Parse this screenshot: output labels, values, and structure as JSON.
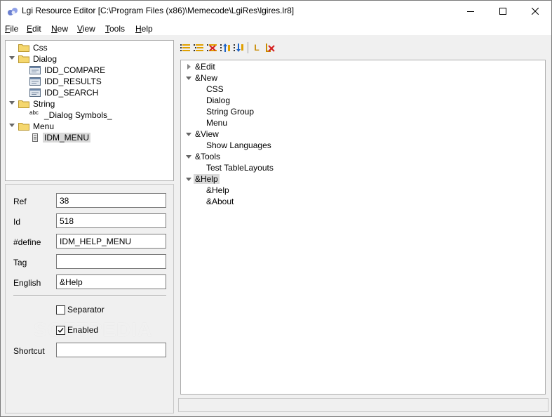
{
  "window": {
    "title": "Lgi Resource Editor [C:\\Program Files (x86)\\Memecode\\LgiRes\\lgires.lr8]"
  },
  "menubar": {
    "items": [
      "File",
      "Edit",
      "New",
      "View",
      "Tools",
      "Help"
    ]
  },
  "resource_tree": {
    "items": [
      {
        "label": "Css",
        "icon": "folder-icon",
        "expanded": false
      },
      {
        "label": "Dialog",
        "icon": "folder-icon",
        "expanded": true
      },
      {
        "label": "IDD_COMPARE",
        "icon": "dialog-icon"
      },
      {
        "label": "IDD_RESULTS",
        "icon": "dialog-icon"
      },
      {
        "label": "IDD_SEARCH",
        "icon": "dialog-icon"
      },
      {
        "label": "String",
        "icon": "folder-icon",
        "expanded": true
      },
      {
        "label": "_Dialog Symbols_",
        "icon": "string-icon",
        "icon_text": "abc"
      },
      {
        "label": "Menu",
        "icon": "folder-icon",
        "expanded": true
      },
      {
        "label": "IDM_MENU",
        "icon": "menu-resource-icon",
        "selected": true
      }
    ]
  },
  "properties": {
    "ref_label": "Ref",
    "ref_value": "38",
    "id_label": "Id",
    "id_value": "518",
    "define_label": "#define",
    "define_value": "IDM_HELP_MENU",
    "tag_label": "Tag",
    "tag_value": "",
    "english_label": "English",
    "english_value": "&Help",
    "separator_label": "Separator",
    "separator_checked": false,
    "enabled_label": "Enabled",
    "enabled_checked": true,
    "shortcut_label": "Shortcut",
    "shortcut_value": ""
  },
  "watermark": "SOFTPEDIA",
  "toolbar": {
    "buttons": [
      "new-item-icon",
      "new-submenu-icon",
      "delete-item-icon",
      "move-up-icon",
      "move-down-icon",
      "new-sub-icon",
      "delete-sub-icon"
    ],
    "sub_letter": "L"
  },
  "menu_tree": {
    "items": [
      {
        "label": "&Edit",
        "level": 0,
        "expander": "closed"
      },
      {
        "label": "&New",
        "level": 0,
        "expander": "open"
      },
      {
        "label": "CSS",
        "level": 1
      },
      {
        "label": "Dialog",
        "level": 1
      },
      {
        "label": "String Group",
        "level": 1
      },
      {
        "label": "Menu",
        "level": 1
      },
      {
        "label": "&View",
        "level": 0,
        "expander": "open"
      },
      {
        "label": "Show Languages",
        "level": 1
      },
      {
        "label": "&Tools",
        "level": 0,
        "expander": "open"
      },
      {
        "label": "Test TableLayouts",
        "level": 1
      },
      {
        "label": "&Help",
        "level": 0,
        "expander": "open",
        "selected": true
      },
      {
        "label": "&Help",
        "level": 1
      },
      {
        "label": "&About",
        "level": 1
      }
    ]
  },
  "colors": {
    "selection": "#d9d9d9",
    "folder": "#f5d76e",
    "accent_blue": "#1e64c8",
    "delete_red": "#d42020"
  }
}
